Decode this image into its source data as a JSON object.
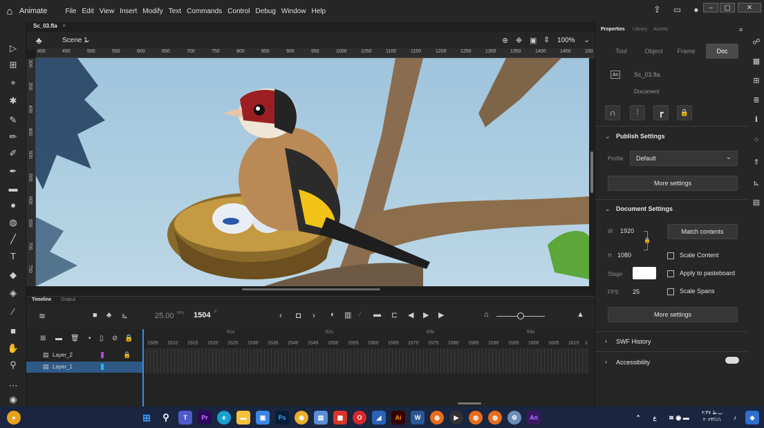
{
  "menubar": {
    "app_name": "Animate",
    "menus": [
      "File",
      "Edit",
      "View",
      "Insert",
      "Modify",
      "Text",
      "Commands",
      "Control",
      "Debug",
      "Window",
      "Help"
    ]
  },
  "document": {
    "tab_name": "Sc_03.fla",
    "scene_name": "Scene 1",
    "zoom": "100%"
  },
  "rulers": {
    "top_ticks": [
      "400",
      "450",
      "500",
      "550",
      "600",
      "650",
      "700",
      "750",
      "800",
      "850",
      "900",
      "950",
      "1000",
      "1050",
      "1100",
      "1150",
      "1200",
      "1250",
      "1300",
      "1350",
      "1400",
      "1450",
      "150"
    ],
    "left_ticks": [
      "300",
      "350",
      "400",
      "450",
      "500",
      "550",
      "600",
      "650",
      "700",
      "750"
    ]
  },
  "timeline": {
    "tab_timeline": "Timeline",
    "tab_output": "Output",
    "fps": "25.00",
    "fps_unit": "FPS",
    "current_frame": "1504",
    "frame_unit": "F",
    "second_marks": [
      "61s",
      "62s",
      "63s",
      "64s"
    ],
    "frame_numbers": [
      "1505",
      "1510",
      "1515",
      "1520",
      "1525",
      "1530",
      "1535",
      "1540",
      "1545",
      "1550",
      "1555",
      "1560",
      "1565",
      "1570",
      "1575",
      "1580",
      "1585",
      "1590",
      "1595",
      "1600",
      "1605",
      "1610",
      "1"
    ],
    "layers": [
      {
        "name": "Layer_2",
        "color": "#b045d8",
        "locked": true
      },
      {
        "name": "Layer_1",
        "color": "#27b5f0",
        "locked": false
      }
    ]
  },
  "properties": {
    "tabs": [
      "Properties",
      "Library",
      "Assets"
    ],
    "subtabs": [
      "Tool",
      "Object",
      "Frame",
      "Doc"
    ],
    "active_subtab": "Doc",
    "file_name": "Sc_03.fla",
    "document_label": "Document",
    "publish_settings": {
      "title": "Publish Settings",
      "profile_label": "Profile",
      "profile_value": "Default",
      "more_settings": "More settings"
    },
    "document_settings": {
      "title": "Document Settings",
      "w_label": "W",
      "w_value": "1920",
      "h_label": "H",
      "h_value": "1080",
      "match_contents": "Match contents",
      "stage_label": "Stage",
      "stage_color": "#ffffff",
      "fps_label": "FPS",
      "fps_value": "25",
      "scale_content": "Scale Content",
      "apply_to_pasteboard": "Apply to pasteboard",
      "scale_spans": "Scale Spans",
      "more_settings": "More settings"
    },
    "swf_history": "SWF History",
    "accessibility": "Accessibility"
  },
  "taskbar": {
    "tray_text": "۲:۳۷ ب.ظ",
    "tray_date": "۲۰۲۳/۱/۱"
  }
}
